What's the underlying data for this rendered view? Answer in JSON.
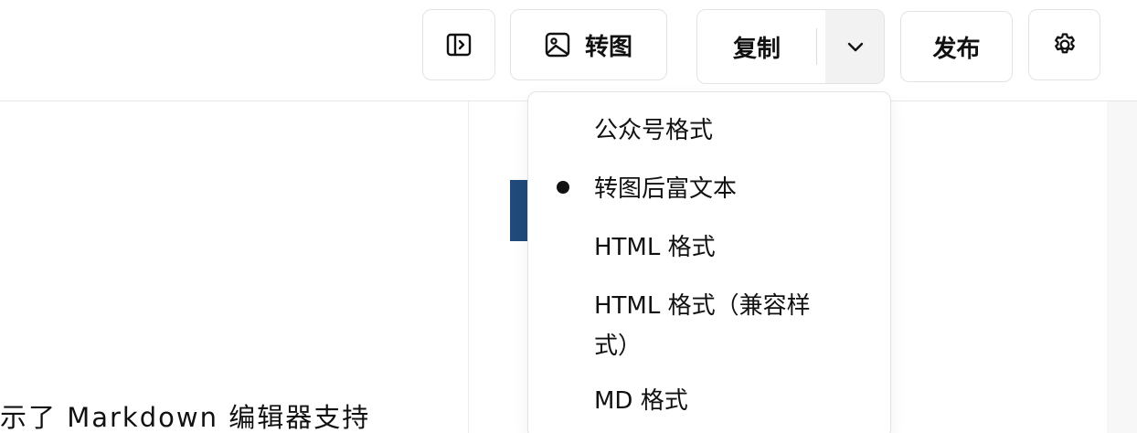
{
  "toolbar": {
    "sidebar_icon": "sidebar-toggle-icon",
    "convert_label": "转图",
    "convert_icon": "image-icon",
    "copy_label": "复制",
    "copy_toggle_icon": "chevron-down-icon",
    "publish_label": "发布",
    "settings_icon": "gear-icon"
  },
  "copy_menu": {
    "items": [
      {
        "label": "公众号格式",
        "selected": false
      },
      {
        "label": "转图后富文本",
        "selected": true
      },
      {
        "label": "HTML 格式",
        "selected": false
      },
      {
        "label": "HTML 格式（兼容样式）",
        "selected": false
      },
      {
        "label": "MD 格式",
        "selected": false
      }
    ]
  },
  "editor": {
    "visible_text": "示了 Markdown 编辑器支持"
  },
  "colors": {
    "heading_accent": "#1f4a7a",
    "border": "#e3e3e3"
  }
}
